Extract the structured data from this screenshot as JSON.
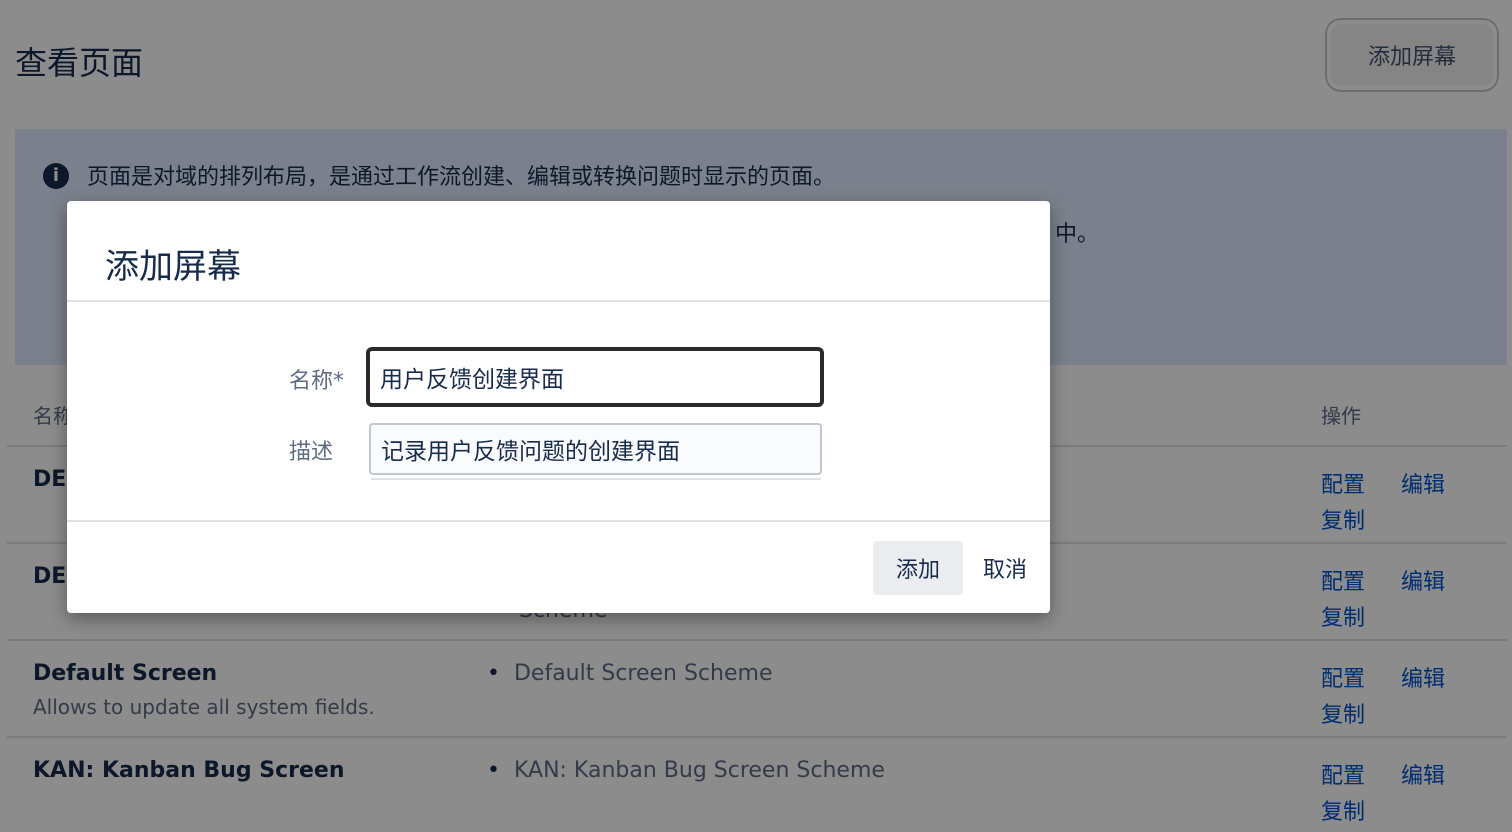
{
  "page": {
    "title": "查看页面",
    "add_screen_button": "添加屏幕"
  },
  "info": {
    "line1": "页面是对域的排列布局，是通过工作流创建、编辑或转换问题时显示的页面。",
    "line2_tail": "中。"
  },
  "table": {
    "col_name": "名称",
    "col_actions": "操作",
    "rows": [
      {
        "name": "DE",
        "description": "",
        "scheme": "",
        "scheme_cont": "",
        "actions": {
          "config": "配置",
          "edit": "编辑",
          "copy": "复制"
        }
      },
      {
        "name": "DE",
        "description": "",
        "scheme": "",
        "scheme_cont": "Scheme",
        "actions": {
          "config": "配置",
          "edit": "编辑",
          "copy": "复制"
        }
      },
      {
        "name": "Default Screen",
        "description": "Allows to update all system fields.",
        "scheme": "Default Screen Scheme",
        "scheme_cont": "",
        "actions": {
          "config": "配置",
          "edit": "编辑",
          "copy": "复制"
        }
      },
      {
        "name": "KAN: Kanban Bug Screen",
        "description": "",
        "scheme": "KAN: Kanban Bug Screen Scheme",
        "scheme_cont": "",
        "actions": {
          "config": "配置",
          "edit": "编辑",
          "copy": "复制"
        }
      }
    ]
  },
  "dialog": {
    "title": "添加屏幕",
    "name_label": "名称*",
    "name_value": "用户反馈创建界面",
    "desc_label": "描述",
    "desc_value": "记录用户反馈问题的创建界面",
    "add_button": "添加",
    "cancel_button": "取消"
  }
}
